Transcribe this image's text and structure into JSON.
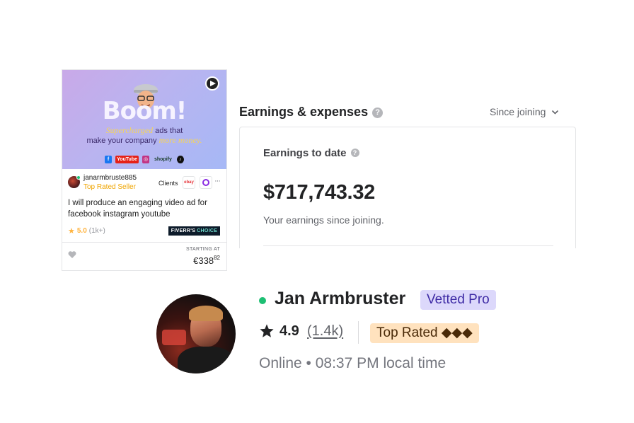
{
  "gig_card": {
    "thumbnail": {
      "headline": "Boom!",
      "line1_highlight": "Supercharged",
      "line1_rest": " ads that",
      "line2_start": "make your company ",
      "line2_highlight": "more money.",
      "brands": [
        "f",
        "YouTube",
        "◎",
        "shopify",
        "♪"
      ]
    },
    "seller": {
      "username": "janarmbruste885",
      "level": "Top Rated Seller"
    },
    "clients_label": "Clients",
    "client_logos": [
      "ebay"
    ],
    "more_label": "···",
    "title": "I will produce an engaging video ad for facebook instagram youtube",
    "rating": "5.0",
    "rating_count": "(1k+)",
    "choice_badge": {
      "prefix": "FIVERR'S",
      "highlight": "CHOICE"
    },
    "starting_at_label": "STARTING AT",
    "price_main": "€338",
    "price_cents": "82"
  },
  "earnings": {
    "header": "Earnings & expenses",
    "help": "?",
    "period_select": "Since joining",
    "label": "Earnings to date",
    "value": "$717,743.32",
    "subtitle": "Your earnings since joining."
  },
  "profile": {
    "name": "Jan Armbruster",
    "vetted_badge": "Vetted Pro",
    "rating": "4.9",
    "review_count": "(1.4k)",
    "top_rated_badge": "Top Rated ◆◆◆",
    "status": "Online • 08:37 PM local time"
  },
  "colors": {
    "online_green": "#1dbf73",
    "rating_gold": "#ffb33e",
    "vetted_bg": "#dcd8fb",
    "toprated_bg": "#ffe2be"
  }
}
